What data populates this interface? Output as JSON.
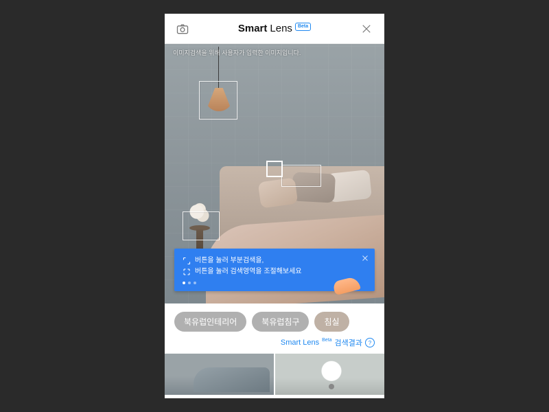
{
  "header": {
    "title_part1": "Smart",
    "title_part2": "Lens",
    "badge": "Beta"
  },
  "image": {
    "caption": "이미지검색을 위해 사용자가 입력한 이미지입니다."
  },
  "tip": {
    "line1": "버튼을 눌러 부분검색을,",
    "line2": "버튼을 눌러 검색영역을 조절해보세요"
  },
  "chips": [
    "북유럽인테리어",
    "북유럽침구",
    "침실"
  ],
  "results": {
    "brand": "Smart Lens",
    "sup": "Beta",
    "label": "검색결과"
  }
}
